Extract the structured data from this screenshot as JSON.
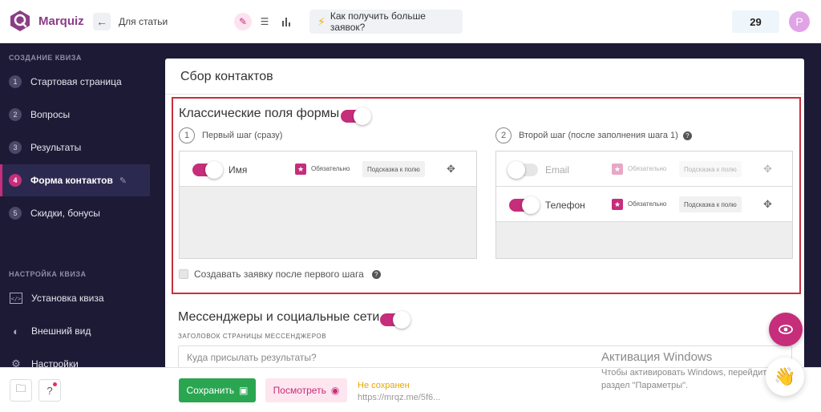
{
  "app": {
    "logo_text": "Marquiz",
    "quiz_name": "Для статьи"
  },
  "topbar": {
    "hint_button": "Как получить больше заявок?",
    "counter": "29",
    "avatar_letter": "P"
  },
  "sidebar": {
    "section1": "СОЗДАНИЕ КВИЗА",
    "items": [
      {
        "num": "1",
        "label": "Стартовая страница"
      },
      {
        "num": "2",
        "label": "Вопросы"
      },
      {
        "num": "3",
        "label": "Результаты"
      },
      {
        "num": "4",
        "label": "Форма контактов"
      },
      {
        "num": "5",
        "label": "Скидки, бонусы"
      }
    ],
    "section2": "НАСТРОЙКА КВИЗА",
    "settings": [
      {
        "label": "Установка квиза"
      },
      {
        "label": "Внешний вид"
      },
      {
        "label": "Настройки"
      }
    ]
  },
  "card": {
    "title": "Сбор контактов",
    "classic": {
      "title": "Классические поля формы",
      "step1": {
        "num": "1",
        "label": "Первый шаг (сразу)"
      },
      "step2": {
        "num": "2",
        "label": "Второй шаг (после заполнения шага 1)"
      },
      "required_label": "Обязательно",
      "hint_label": "Подсказка к полю",
      "step1_fields": [
        {
          "name": "Имя",
          "enabled": true
        }
      ],
      "step2_fields": [
        {
          "name": "Email",
          "enabled": false
        },
        {
          "name": "Телефон",
          "enabled": true
        }
      ],
      "checkbox_label": "Создавать заявку после первого шага"
    },
    "messengers": {
      "title": "Мессенджеры и социальные сети",
      "field_label": "ЗАГОЛОВОК СТРАНИЦЫ МЕССЕНДЖЕРОВ",
      "placeholder": "Куда присылать результаты?"
    }
  },
  "bottombar": {
    "save": "Сохранить",
    "preview": "Посмотреть",
    "status": "Не сохранен",
    "url": "https://mrqz.me/5f6..."
  },
  "activation": {
    "title": "Активация Windows",
    "line1": "Чтобы активировать Windows, перейдите в",
    "line2": "раздел \"Параметры\"."
  },
  "colors": {
    "accent": "#c62d7a",
    "sidebar_bg": "#1c1a35",
    "save_green": "#2aa650",
    "highlight_border": "#c8303c"
  }
}
